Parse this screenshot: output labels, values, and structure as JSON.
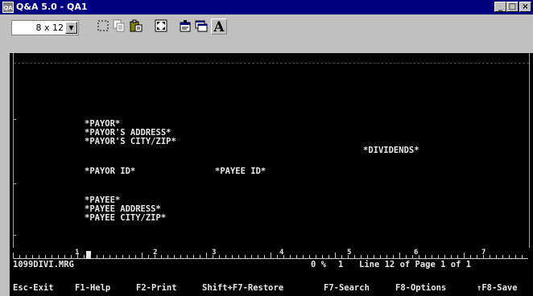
{
  "window": {
    "title": "Q&A 5.0 - QA1",
    "icon_label": "QA",
    "minimize_label": "_",
    "maximize_label": "□",
    "close_label": "×"
  },
  "toolbar": {
    "font_size_value": "8 x 12",
    "dropdown_arrow": "▼",
    "font_button_label": "A",
    "icons": [
      "mark-icon",
      "copy-icon",
      "paste-icon",
      "fullscreen-icon",
      "properties-icon",
      "background-icon",
      "font-icon"
    ]
  },
  "document": {
    "fields": {
      "payor": "*PAYOR*",
      "payor_address": "*PAYOR'S ADDRESS*",
      "payor_city_zip": "*PAYOR'S CITY/ZIP*",
      "dividends": "*DIVIDENDS*",
      "payor_id": "*PAYOR ID*",
      "payee_id": "*PAYEE ID*",
      "payee": "*PAYEE*",
      "payee_address": "*PAYEE ADDRESS*",
      "payee_city_zip": "*PAYEE CITY/ZIP*"
    }
  },
  "ruler": {
    "numbers": [
      "1",
      "2",
      "3",
      "4",
      "5",
      "6",
      "7"
    ]
  },
  "status": {
    "filename": "1099DIVI.MRG",
    "percent": "0 %",
    "percent_value": "1",
    "position": "Line 12 of Page 1 of 1"
  },
  "function_keys": {
    "exit": "Esc-Exit",
    "help": "F1-Help",
    "print": "F2-Print",
    "restore": "Shift+F7-Restore",
    "search": "F7-Search",
    "options": "F8-Options",
    "save": "↑F8-Save"
  },
  "colors": {
    "title_bar": "#000080",
    "screen_background": "#000000",
    "screen_text": "#e8e8e8",
    "chrome": "#c0c0c0"
  }
}
